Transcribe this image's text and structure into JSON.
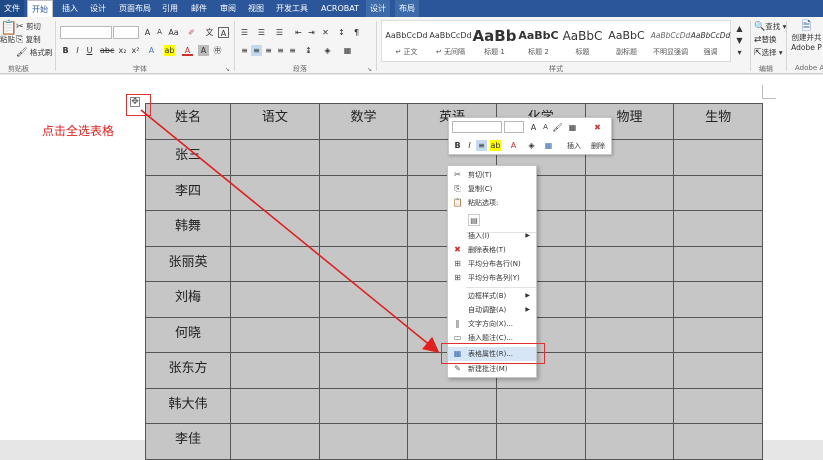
{
  "tabs": [
    "文件",
    "开始",
    "插入",
    "设计",
    "页面布局",
    "引用",
    "邮件",
    "审阅",
    "视图",
    "开发工具",
    "ACROBAT",
    "设计",
    "布局"
  ],
  "active_tab": 1,
  "ribbon": {
    "clipboard": {
      "cut": "剪切",
      "copy": "复制",
      "format_painter": "格式刷",
      "paste": "粘贴",
      "group": "剪贴板"
    },
    "font_group": "字体",
    "paragraph_group": "段落",
    "styles_group": "样式",
    "editing": {
      "find": "查找",
      "replace": "替换",
      "select": "选择",
      "group": "编辑"
    },
    "adobe": {
      "line1": "创建并共",
      "line2": "Adobe P",
      "group": "Adobe A"
    },
    "styles": [
      {
        "preview": "AaBbCcDd",
        "name": "↵ 正文"
      },
      {
        "preview": "AaBbCcDd",
        "name": "↵ 无间隔"
      },
      {
        "preview": "AaBb",
        "name": "标题 1"
      },
      {
        "preview": "AaBbC",
        "name": "标题 2"
      },
      {
        "preview": "AaBbC",
        "name": "标题"
      },
      {
        "preview": "AaBbC",
        "name": "副标题"
      },
      {
        "preview": "AaBbCcDd",
        "name": "不明显强调"
      },
      {
        "preview": "AaBbCcDd",
        "name": "强调"
      }
    ]
  },
  "annotation": "点击全选表格",
  "table": {
    "headers": [
      "姓名",
      "语文",
      "数学",
      "英语",
      "化学",
      "物理",
      "生物"
    ],
    "names": [
      "张三",
      "李四",
      "韩舞",
      "张丽英",
      "刘梅",
      "何晓",
      "张东方",
      "韩大伟",
      "李佳"
    ]
  },
  "mini_toolbar": {
    "insert": "插入",
    "delete": "删除"
  },
  "context_menu": [
    {
      "label": "剪切(T)",
      "icon": "✂"
    },
    {
      "label": "复制(C)",
      "icon": "⎘"
    },
    {
      "label": "粘贴选项:",
      "icon": "📋"
    },
    {
      "label": "",
      "icon": "▤"
    },
    {
      "label": "插入(I)",
      "icon": "",
      "submenu": true
    },
    {
      "label": "删除表格(T)",
      "icon": "✖"
    },
    {
      "label": "平均分布各行(N)",
      "icon": "⊞"
    },
    {
      "label": "平均分布各列(Y)",
      "icon": "⊞"
    },
    {
      "label": "边框样式(B)",
      "icon": "",
      "submenu": true
    },
    {
      "label": "自动调整(A)",
      "icon": "",
      "submenu": true
    },
    {
      "label": "文字方向(X)...",
      "icon": "‖"
    },
    {
      "label": "插入题注(C)...",
      "icon": "▭"
    },
    {
      "label": "表格属性(R)...",
      "icon": "▦"
    },
    {
      "label": "新建批注(M)",
      "icon": "✎"
    }
  ]
}
